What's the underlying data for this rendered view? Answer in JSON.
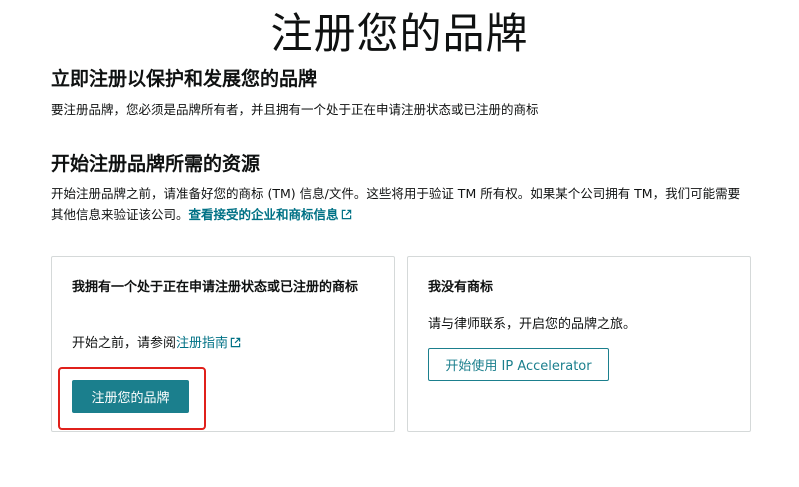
{
  "page": {
    "title": "注册您的品牌"
  },
  "intro": {
    "heading": "立即注册以保护和发展您的品牌",
    "description": "要注册品牌，您必须是品牌所有者，并且拥有一个处于正在申请注册状态或已注册的商标"
  },
  "resources": {
    "heading": "开始注册品牌所需的资源",
    "description": "开始注册品牌之前，请准备好您的商标 (TM) 信息/文件。这些将用于验证 TM 所有权。如果某个公司拥有 TM，我们可能需要其他信息来验证该公司。",
    "link_text": "查看接受的企业和商标信息"
  },
  "card_left": {
    "title": "我拥有一个处于正在申请注册状态或已注册的商标",
    "text_prefix": "开始之前，请参阅",
    "link_text": "注册指南",
    "button_label": "注册您的品牌"
  },
  "card_right": {
    "title": "我没有商标",
    "text": "请与律师联系，开启您的品牌之旅。",
    "button_label": "开始使用 IP Accelerator"
  },
  "colors": {
    "accent": "#1b7f8d",
    "link": "#007185",
    "highlight": "#e0201b",
    "border": "#d5d9d9"
  },
  "icons": {
    "external_link": "external-link-icon"
  }
}
